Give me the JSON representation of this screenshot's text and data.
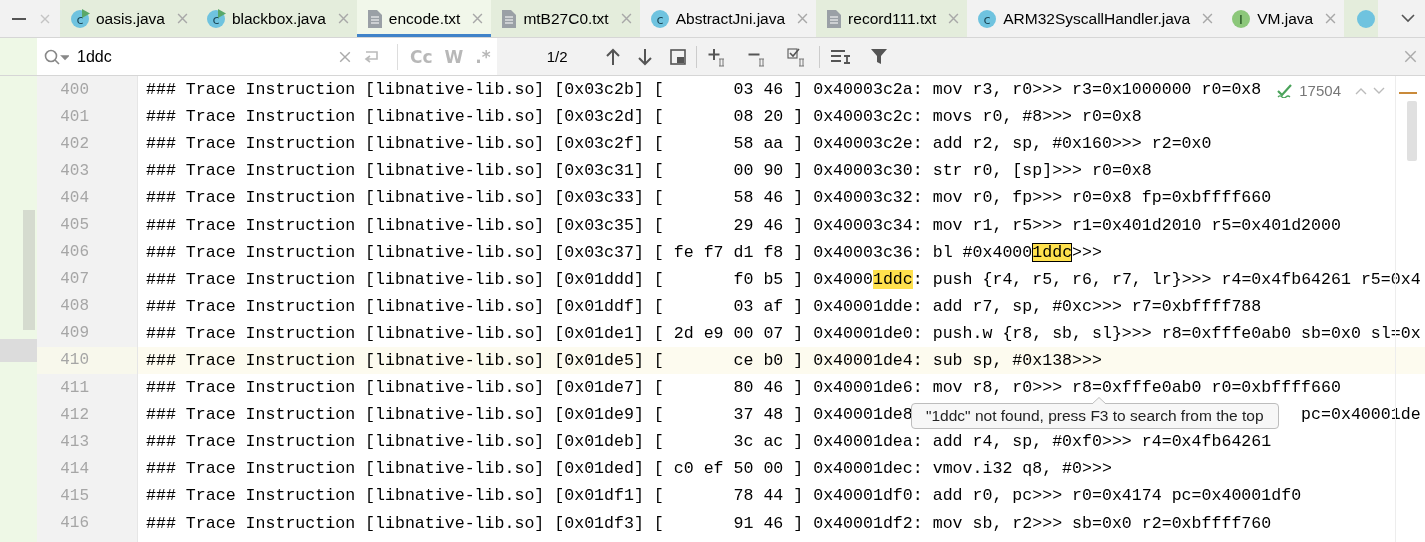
{
  "tabs": [
    {
      "kind": "class",
      "badge": "c",
      "label": "oasis.java",
      "color": "#e4eddc",
      "selected": false
    },
    {
      "kind": "class",
      "badge": "c",
      "label": "blackbox.java",
      "color": "#e4eddc",
      "selected": false
    },
    {
      "kind": "text",
      "label": "encode.txt",
      "color": "#f1f7ea",
      "selected": true
    },
    {
      "kind": "text",
      "label": "mtB27C0.txt",
      "color": "#e4eddc",
      "selected": false
    },
    {
      "kind": "class",
      "badge": "c",
      "label": "AbstractJni.java",
      "color": "#f2f2f2",
      "selected": false
    },
    {
      "kind": "text",
      "label": "record111.txt",
      "color": "#e4eddc",
      "selected": false
    },
    {
      "kind": "class",
      "badge": "c",
      "label": "ARM32SyscallHandler.java",
      "color": "#f2f2f2",
      "selected": false
    },
    {
      "kind": "interface",
      "badge": "I",
      "label": "VM.java",
      "color": "#f2f2f2",
      "selected": false
    },
    {
      "kind": "class",
      "color": "#e4eddc",
      "selected": false
    }
  ],
  "search": {
    "query": "1ddc",
    "options": [
      "Cc",
      "W",
      ".*"
    ],
    "match_count": "1/2"
  },
  "inspection": {
    "count": "17504"
  },
  "rows": [
    {
      "number": "400",
      "text": "### Trace Instruction [libnative-lib.so] [0x03c2b] [       03 46 ] 0x40003c2a: mov r3, r0>>> r3=0x1000000 r0=0x8",
      "current": false
    },
    {
      "number": "401",
      "text": "### Trace Instruction [libnative-lib.so] [0x03c2d] [       08 20 ] 0x40003c2c: movs r0, #8>>> r0=0x8",
      "current": false
    },
    {
      "number": "402",
      "text": "### Trace Instruction [libnative-lib.so] [0x03c2f] [       58 aa ] 0x40003c2e: add r2, sp, #0x160>>> r2=0x0",
      "current": false
    },
    {
      "number": "403",
      "text": "### Trace Instruction [libnative-lib.so] [0x03c31] [       00 90 ] 0x40003c30: str r0, [sp]>>> r0=0x8",
      "current": false
    },
    {
      "number": "404",
      "text": "### Trace Instruction [libnative-lib.so] [0x03c33] [       58 46 ] 0x40003c32: mov r0, fp>>> r0=0x8 fp=0xbffff660",
      "current": false
    },
    {
      "number": "405",
      "text": "### Trace Instruction [libnative-lib.so] [0x03c35] [       29 46 ] 0x40003c34: mov r1, r5>>> r1=0x401d2010 r5=0x401d2000",
      "current": false
    },
    {
      "number": "406",
      "text": "### Trace Instruction [libnative-lib.so] [0x03c37] [ fe f7 d1 f8 ] 0x40003c36: bl #0x4000",
      "match": {
        "text": "1ddc",
        "selected": true
      },
      "after": ">>>",
      "current": false
    },
    {
      "number": "407",
      "text": "### Trace Instruction [libnative-lib.so] [0x01ddd] [       f0 b5 ] 0x4000",
      "match": {
        "text": "1ddc",
        "selected": false
      },
      "after": ": push {r4, r5, r6, r7, lr}>>> r4=0x4fb64261 r5=0x4",
      "current": false
    },
    {
      "number": "408",
      "text": "### Trace Instruction [libnative-lib.so] [0x01ddf] [       03 af ] 0x40001dde: add r7, sp, #0xc>>> r7=0xbffff788",
      "current": false
    },
    {
      "number": "409",
      "text": "### Trace Instruction [libnative-lib.so] [0x01de1] [ 2d e9 00 07 ] 0x40001de0: push.w {r8, sb, sl}>>> r8=0xfffe0ab0 sb=0x0 sl=0x",
      "current": false
    },
    {
      "number": "410",
      "text": "### Trace Instruction [libnative-lib.so] [0x01de5] [       ce b0 ] 0x40001de4: sub sp, #0x138>>>",
      "current": true
    },
    {
      "number": "411",
      "text": "### Trace Instruction [libnative-lib.so] [0x01de7] [       80 46 ] 0x40001de6: mov r8, r0>>> r8=0xfffe0ab0 r0=0xbffff660",
      "current": false
    },
    {
      "number": "412",
      "text": "### Trace Instruction [libnative-lib.so] [0x01de9] [       37 48 ] 0x40001de8",
      "tail": "pc=0x40001de",
      "current": false
    },
    {
      "number": "413",
      "text": "### Trace Instruction [libnative-lib.so] [0x01deb] [       3c ac ] 0x40001dea: add r4, sp, #0xf0>>> r4=0x4fb64261",
      "current": false
    },
    {
      "number": "414",
      "text": "### Trace Instruction [libnative-lib.so] [0x01ded] [ c0 ef 50 00 ] 0x40001dec: vmov.i32 q8, #0>>>",
      "current": false
    },
    {
      "number": "415",
      "text": "### Trace Instruction [libnative-lib.so] [0x01df1] [       78 44 ] 0x40001df0: add r0, pc>>> r0=0x4174 pc=0x40001df0",
      "current": false
    },
    {
      "number": "416",
      "text": "### Trace Instruction [libnative-lib.so] [0x01df3] [       91 46 ] 0x40001df2: mov sb, r2>>> sb=0x0 r2=0xbffff760",
      "current": false
    }
  ],
  "tooltip": {
    "text": "\"1ddc\" not found, press F3 to search from the top"
  }
}
